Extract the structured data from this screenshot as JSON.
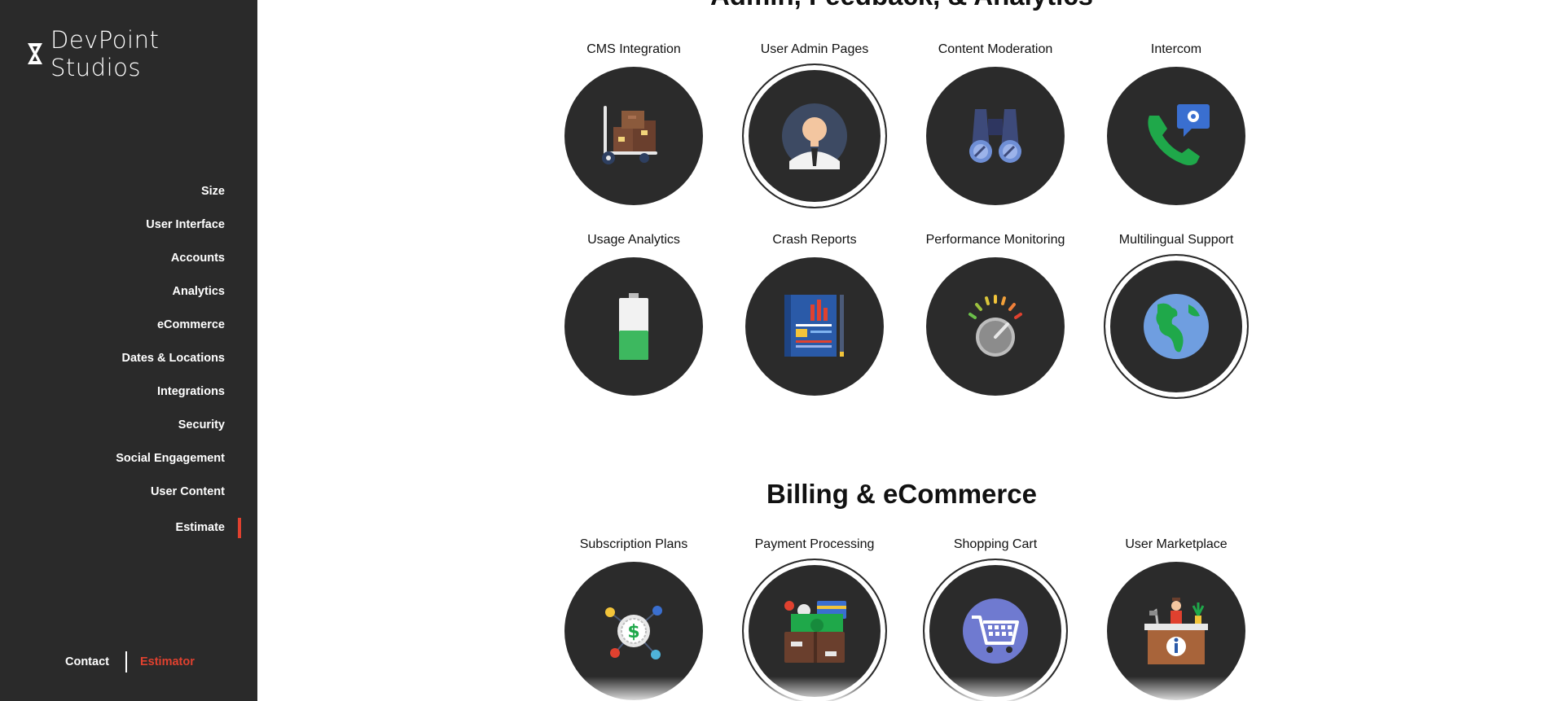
{
  "brand": {
    "name": "DevPoint Studios"
  },
  "nav": {
    "items": [
      {
        "label": "Size"
      },
      {
        "label": "User Interface"
      },
      {
        "label": "Accounts"
      },
      {
        "label": "Analytics"
      },
      {
        "label": "eCommerce"
      },
      {
        "label": "Dates & Locations"
      },
      {
        "label": "Integrations"
      },
      {
        "label": "Security"
      },
      {
        "label": "Social Engagement"
      },
      {
        "label": "User Content"
      },
      {
        "label": "Estimate"
      }
    ],
    "active": "Estimate"
  },
  "footer": {
    "contact": "Contact",
    "estimator": "Estimator"
  },
  "colors": {
    "sidebar": "#2a2a2a",
    "accent": "#e0412f",
    "circle": "#2b2b2b"
  },
  "sections": [
    {
      "title": "Admin, Feedback, & Analytics",
      "features": [
        {
          "label": "CMS Integration",
          "icon": "hand-truck-boxes-icon",
          "selected": false
        },
        {
          "label": "User Admin Pages",
          "icon": "admin-user-icon",
          "selected": true
        },
        {
          "label": "Content Moderation",
          "icon": "binoculars-icon",
          "selected": false
        },
        {
          "label": "Intercom",
          "icon": "phone-chat-icon",
          "selected": false
        },
        {
          "label": "Usage Analytics",
          "icon": "battery-icon",
          "selected": false
        },
        {
          "label": "Crash Reports",
          "icon": "report-blueprint-icon",
          "selected": false
        },
        {
          "label": "Performance Monitoring",
          "icon": "gauge-dial-icon",
          "selected": false
        },
        {
          "label": "Multilingual Support",
          "icon": "globe-icon",
          "selected": true
        }
      ]
    },
    {
      "title": "Billing & eCommerce",
      "features": [
        {
          "label": "Subscription Plans",
          "icon": "dollar-network-icon",
          "selected": false
        },
        {
          "label": "Payment Processing",
          "icon": "wallet-cash-icon",
          "selected": true
        },
        {
          "label": "Shopping Cart",
          "icon": "shopping-cart-icon",
          "selected": true
        },
        {
          "label": "User Marketplace",
          "icon": "info-desk-icon",
          "selected": false
        }
      ]
    }
  ]
}
